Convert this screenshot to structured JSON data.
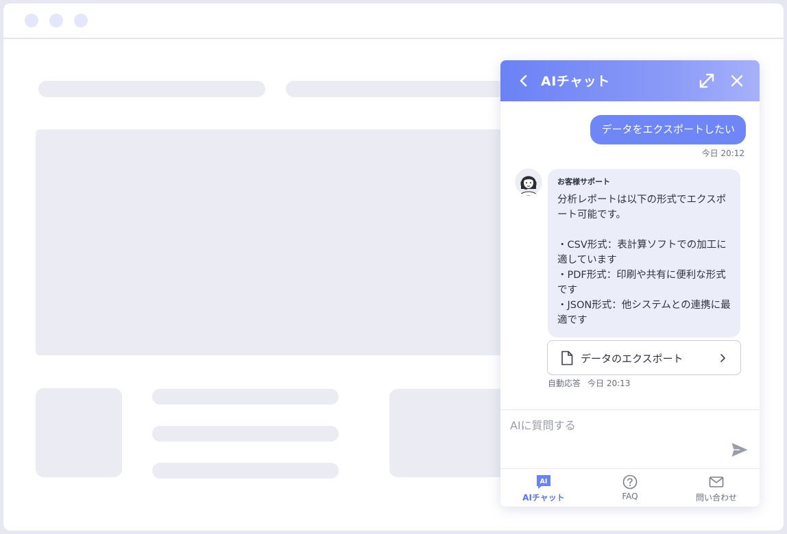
{
  "chat": {
    "title": "AIチャット",
    "messages": {
      "user": {
        "text": "データをエクスポートしたい",
        "time": "今日 20:12"
      },
      "bot": {
        "name": "お客様サポート",
        "text": "分析レポートは以下の形式でエクスポート可能です。\n\n・CSV形式：表計算ソフトでの加工に適しています\n・PDF形式：印刷や共有に便利な形式です\n・JSON形式：他システムとの連携に最適です",
        "link_label": "データのエクスポート",
        "meta_label": "自動応答",
        "time": "今日 20:13"
      }
    },
    "input": {
      "placeholder": "AIに質問する",
      "value": ""
    },
    "tabs": [
      {
        "label": "AIチャット",
        "icon": "ai-chat-icon",
        "active": true,
        "badge": "AI"
      },
      {
        "label": "FAQ",
        "icon": "question-circle-icon",
        "active": false
      },
      {
        "label": "問い合わせ",
        "icon": "mail-icon",
        "active": false
      }
    ]
  },
  "colors": {
    "accent": "#6b82f6",
    "header_gradient_end": "#a7b1fa",
    "bot_bubble": "#ebeef8",
    "placeholder_block": "#eaebf3",
    "page_frame": "#e6e7f0"
  }
}
